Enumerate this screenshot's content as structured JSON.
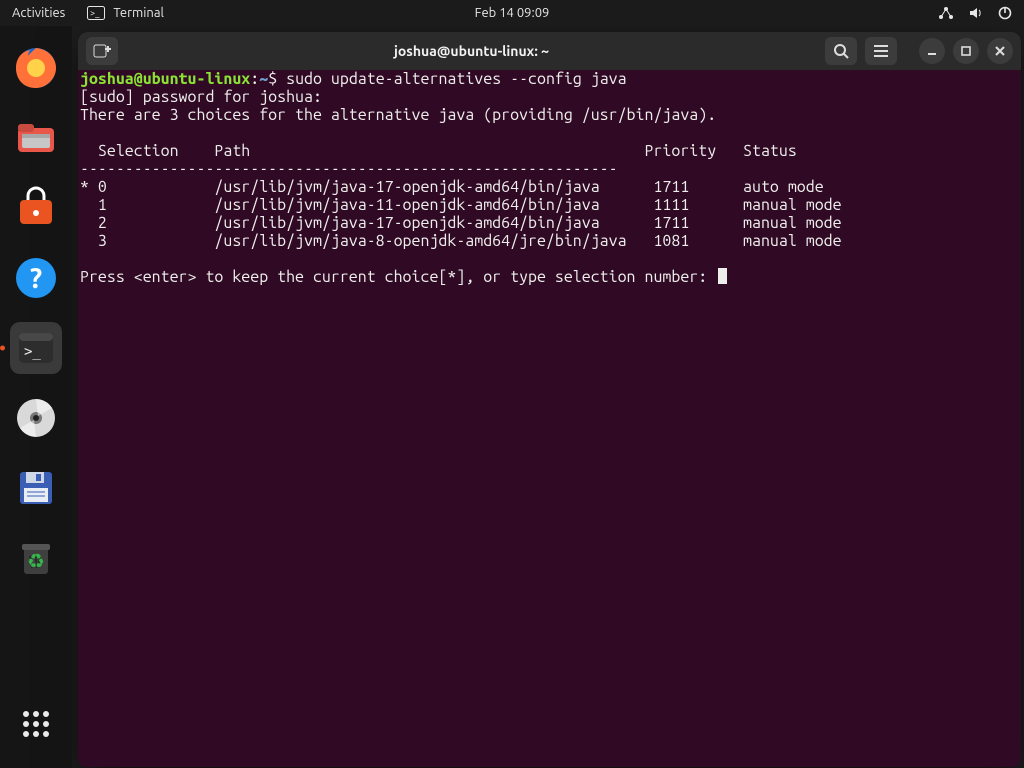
{
  "topbar": {
    "activities": "Activities",
    "app_name": "Terminal",
    "clock": "Feb 14  09:09"
  },
  "dock_items": [
    {
      "name": "firefox",
      "active": false
    },
    {
      "name": "files",
      "active": false
    },
    {
      "name": "software",
      "active": false
    },
    {
      "name": "help",
      "active": false
    },
    {
      "name": "terminal",
      "active": true
    },
    {
      "name": "disc",
      "active": false
    },
    {
      "name": "floppy",
      "active": false
    },
    {
      "name": "trash",
      "active": false
    }
  ],
  "terminal": {
    "title": "joshua@ubuntu-linux: ~",
    "prompt": {
      "user": "joshua@ubuntu-linux",
      "sep": ":",
      "path": "~",
      "mark": "$"
    },
    "command": "sudo update-alternatives --config java",
    "out1": "[sudo] password for joshua:",
    "out2": "There are 3 choices for the alternative java (providing /usr/bin/java).",
    "blank": "",
    "header_line": "  Selection    Path                                            Priority   Status",
    "rule_line": "------------------------------------------------------------",
    "rows": [
      "* 0            /usr/lib/jvm/java-17-openjdk-amd64/bin/java      1711      auto mode",
      "  1            /usr/lib/jvm/java-11-openjdk-amd64/bin/java      1111      manual mode",
      "  2            /usr/lib/jvm/java-17-openjdk-amd64/bin/java      1711      manual mode",
      "  3            /usr/lib/jvm/java-8-openjdk-amd64/jre/bin/java   1081      manual mode"
    ],
    "prompt2": "Press <enter> to keep the current choice[*], or type selection number: "
  }
}
